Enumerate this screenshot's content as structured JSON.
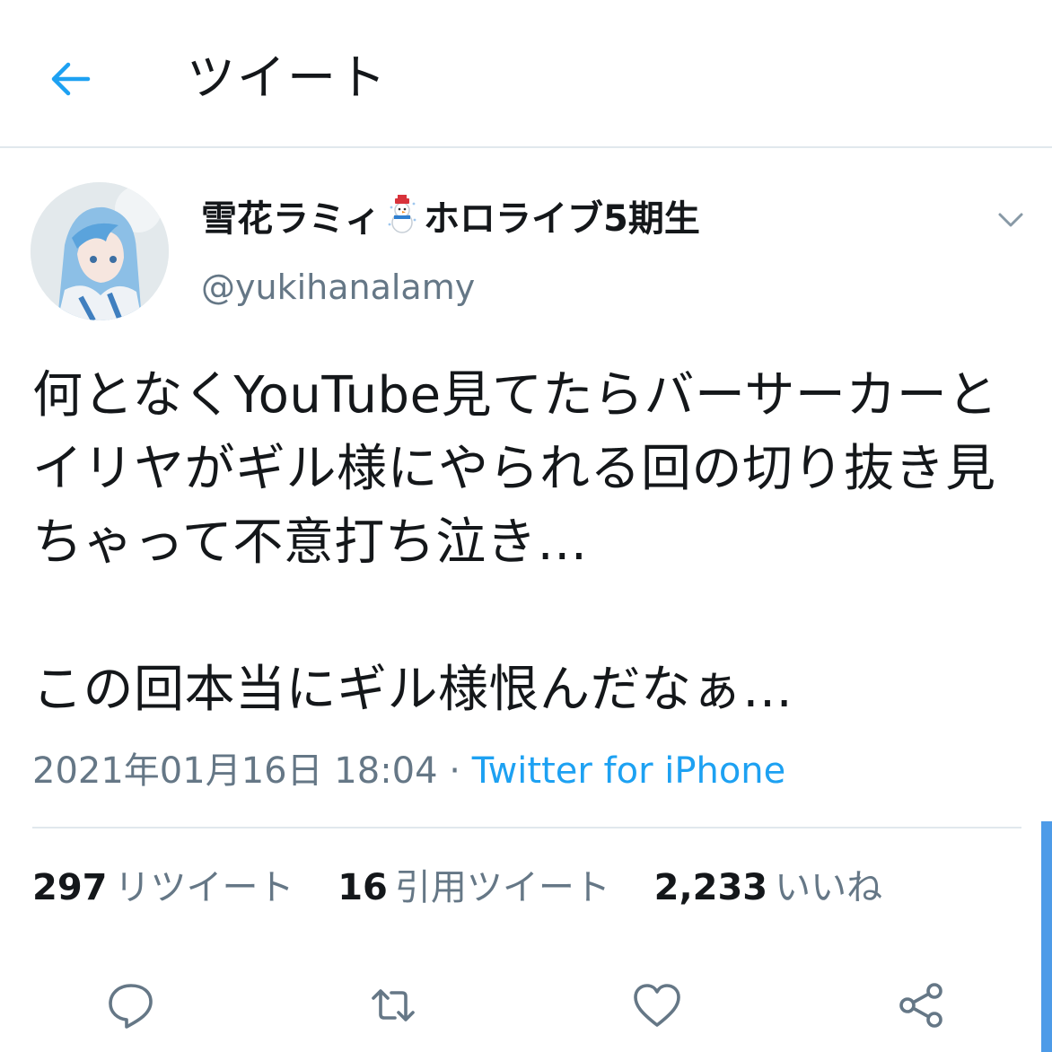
{
  "header": {
    "title": "ツイート",
    "back_icon": "arrow-left-icon",
    "accent_color": "#1da1f2"
  },
  "user": {
    "display_name_part1": "雪花ラミィ",
    "display_name_emoji": "snowman",
    "display_name_part2": "ホロライブ5期生",
    "handle": "@yukihanalamy"
  },
  "tweet": {
    "text": "何となくYouTube見てたらバーサーカーとイリヤがギル様にやられる回の切り抜き見ちゃって不意打ち泣き…\n\nこの回本当にギル様恨んだなぁ…",
    "timestamp": "2021年01月16日 18:04",
    "separator": " · ",
    "source": "Twitter for iPhone"
  },
  "stats": [
    {
      "count": "297",
      "label": "リツイート"
    },
    {
      "count": "16",
      "label": "引用ツイート"
    },
    {
      "count": "2,233",
      "label": "いいね"
    }
  ],
  "actions": [
    "reply-icon",
    "retweet-icon",
    "like-icon",
    "share-icon"
  ]
}
